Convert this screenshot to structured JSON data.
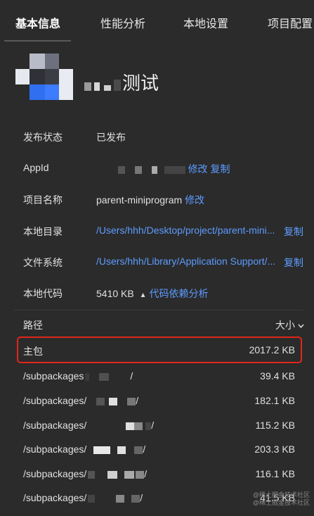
{
  "tabs": [
    {
      "label": "基本信息",
      "active": true
    },
    {
      "label": "性能分析",
      "active": false
    },
    {
      "label": "本地设置",
      "active": false
    },
    {
      "label": "项目配置",
      "active": false
    }
  ],
  "app": {
    "title_suffix": "测试"
  },
  "info": {
    "status": {
      "label": "发布状态",
      "value": "已发布"
    },
    "appid": {
      "label": "AppId",
      "edit": "修改",
      "copy": "复制"
    },
    "project_name": {
      "label": "项目名称",
      "value": "parent-miniprogram",
      "edit": "修改"
    },
    "local_dir": {
      "label": "本地目录",
      "value": "/Users/hhh/Desktop/project/parent-mini...",
      "copy": "复制"
    },
    "file_system": {
      "label": "文件系统",
      "value": "/Users/hhh/Library/Application Support/...",
      "copy": "复制"
    },
    "local_code": {
      "label": "本地代码",
      "value": "5410 KB",
      "chevron": "▲",
      "link": "代码依赖分析"
    }
  },
  "table": {
    "col_path": "路径",
    "col_size": "大小",
    "sort_icon": "chevron-down-icon",
    "rows": [
      {
        "name": "主包",
        "size": "2017.2 KB"
      },
      {
        "name": "/subpackages",
        "suffix": "/",
        "size": "39.4 KB"
      },
      {
        "name": "/subpackages/",
        "suffix": "/",
        "size": "182.1 KB"
      },
      {
        "name": "/subpackages/",
        "suffix": "/",
        "size": "115.2 KB"
      },
      {
        "name": "/subpackages/",
        "suffix": "/",
        "size": "203.3 KB"
      },
      {
        "name": "/subpackages/",
        "suffix": "/",
        "size": "116.1 KB"
      },
      {
        "name": "/subpackages/",
        "suffix": "/",
        "size": "41.5 KB"
      }
    ]
  },
  "watermark": {
    "line1": "@稀土掘金技术社区",
    "line2": "@稀土掘金技术社区"
  },
  "colors": {
    "background": "#2b2b2b",
    "link": "#5d9cff",
    "highlight": "#e0261c"
  }
}
